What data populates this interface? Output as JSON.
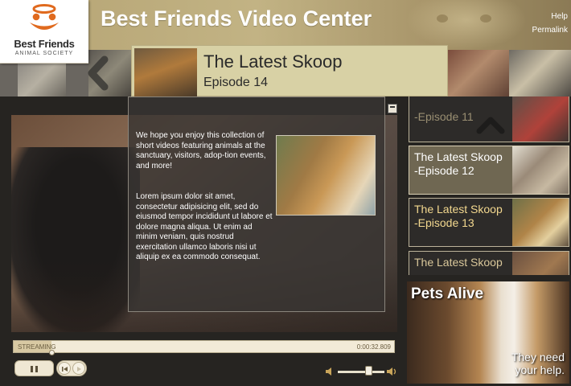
{
  "header": {
    "title": "Best Friends Video Center",
    "help": "Help",
    "permalink": "Permalink"
  },
  "logo": {
    "name": "Best Friends",
    "society": "ANIMAL SOCIETY",
    "brand_color": "#e06a1e"
  },
  "now_playing": {
    "title": "The Latest Skoop",
    "episode": "Episode 14"
  },
  "overlay": {
    "paragraph1": "We hope you enjoy this collection of short videos featuring animals at the sanctuary, visitors, adop-tion events, and more!",
    "paragraph2": "Lorem ipsum dolor sit amet, consectetur adipisicing elit, sed do eiusmod tempor incididunt ut labore et dolore magna aliqua. Ut enim ad minim veniam, quis nostrud exercitation ullamco laboris nisi ut aliquip ex ea commodo consequat."
  },
  "player": {
    "status": "STREAMING",
    "time": "0:00:32.809",
    "progress_fraction": 0.1,
    "volume_fraction": 0.65
  },
  "playlist": [
    {
      "label": "-Episode 11",
      "state": "partial"
    },
    {
      "label": "The Latest Skoop -Episode 12",
      "state": "selected"
    },
    {
      "label": "The Latest Skoop -Episode 13",
      "state": "normal"
    },
    {
      "label": "The Latest Skoop",
      "state": "partial"
    }
  ],
  "ad": {
    "headline": "Pets Alive",
    "tagline_line1": "They need",
    "tagline_line2": "your help."
  },
  "colors": {
    "header_tan": "#c2b384",
    "episode_banner": "#d8d1a5",
    "playlist_text_highlight": "#f3d88f",
    "panel_dark": "#383432"
  }
}
